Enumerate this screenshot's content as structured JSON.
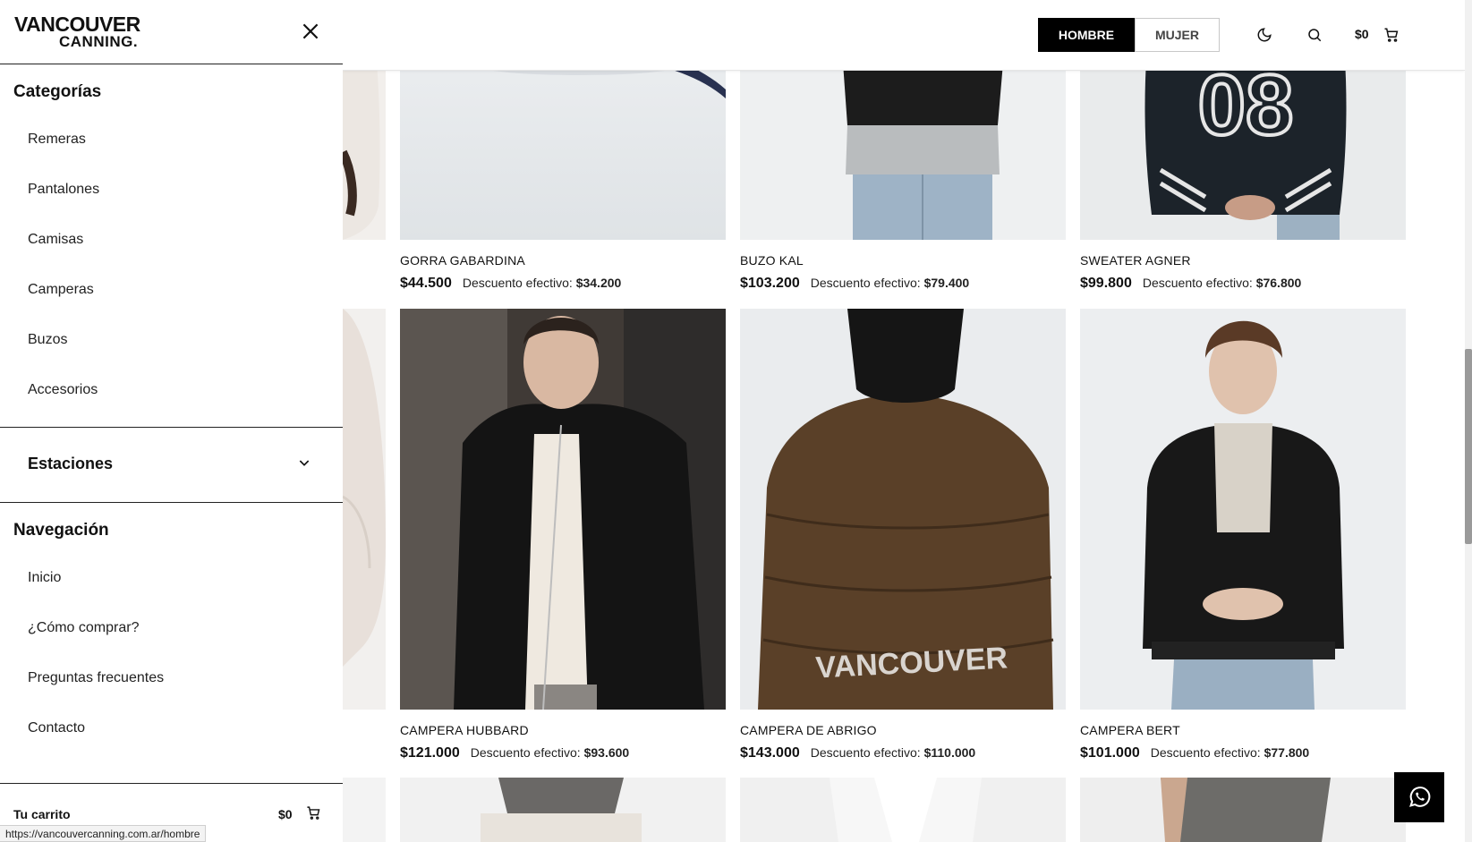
{
  "brand": {
    "line1": "VANCOUVER",
    "line2": "CANNING."
  },
  "header": {
    "gender_tabs": [
      {
        "label": "HOMBRE",
        "active": true
      },
      {
        "label": "MUJER",
        "active": false
      }
    ],
    "cart_total": "$0",
    "icons": [
      "moon-icon",
      "search-icon",
      "cart-icon"
    ]
  },
  "sidebar": {
    "categories_title": "Categorías",
    "categories": [
      "Remeras",
      "Pantalones",
      "Camisas",
      "Camperas",
      "Buzos",
      "Accesorios"
    ],
    "seasons_title": "Estaciones",
    "navigation_title": "Navegación",
    "navigation": [
      "Inicio",
      "¿Cómo comprar?",
      "Preguntas frecuentes",
      "Contacto"
    ],
    "cart_label": "Tu carrito",
    "cart_total": "$0"
  },
  "products_row1": [
    {
      "name": "GORRA GABARDINA",
      "price": "$44.500",
      "discount_label": "Descuento efectivo:",
      "discount_price": "$34.200"
    },
    {
      "name": "BUZO KAL",
      "price": "$103.200",
      "discount_label": "Descuento efectivo:",
      "discount_price": "$79.400"
    },
    {
      "name": "SWEATER AGNER",
      "price": "$99.800",
      "discount_label": "Descuento efectivo:",
      "discount_price": "$76.800"
    }
  ],
  "products_row2": [
    {
      "name": "CAMPERA HUBBARD",
      "price": "$121.000",
      "discount_label": "Descuento efectivo:",
      "discount_price": "$93.600"
    },
    {
      "name": "CAMPERA DE ABRIGO",
      "price": "$143.000",
      "discount_label": "Descuento efectivo:",
      "discount_price": "$110.000"
    },
    {
      "name": "CAMPERA BERT",
      "price": "$101.000",
      "discount_label": "Descuento efectivo:",
      "discount_price": "$77.800"
    }
  ],
  "image_text": {
    "jacket_print": "VANCOUVER",
    "sweater_number": "08"
  },
  "status_bar_url": "https://vancouvercanning.com.ar/hombre",
  "colors": {
    "accent": "#000000",
    "background": "#ffffff",
    "text": "#111111"
  }
}
